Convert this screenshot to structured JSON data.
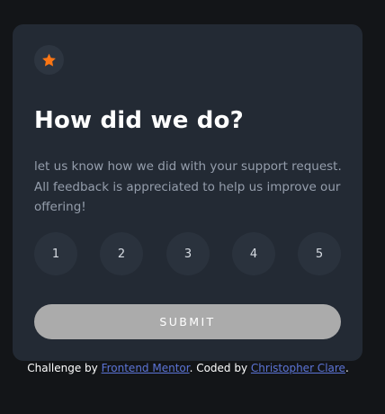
{
  "card": {
    "title": "How did we do?",
    "description": "let us know how we did with your support request. All feedback is appreciated to help us improve our offering!",
    "star_icon": "star-icon",
    "ratings": [
      "1",
      "2",
      "3",
      "4",
      "5"
    ],
    "submit_label": "SUBMIT"
  },
  "attribution": {
    "prefix": "Challenge by ",
    "frontend_mentor": "Frontend Mentor",
    "middle": ". Coded by ",
    "author": "Christopher Clare",
    "suffix": "."
  },
  "colors": {
    "background": "#131518",
    "card": "#232a34",
    "accent": "#fc7614",
    "submit": "#ababab",
    "link": "#5c74d6"
  }
}
